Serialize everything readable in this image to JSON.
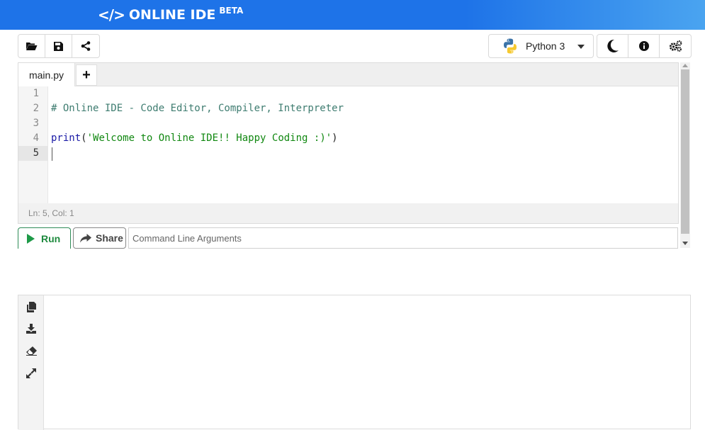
{
  "header": {
    "brand_symbol": "</>",
    "brand_name": "ONLINE IDE",
    "brand_badge": "BETA",
    "gradient_start": "#1e73e8",
    "gradient_end": "#4aa4f0"
  },
  "toolbar": {
    "left_icons": [
      "folder-open-icon",
      "save-icon",
      "share-nodes-icon"
    ],
    "language": "Python 3",
    "right_icons": [
      "moon-icon",
      "info-icon",
      "gears-icon"
    ]
  },
  "editor": {
    "tab_label": "main.py",
    "add_tab_label": "+",
    "line_numbers": [
      "1",
      "2",
      "3",
      "4",
      "5"
    ],
    "lines": {
      "l2": "# Online IDE - Code Editor, Compiler, Interpreter",
      "l4_fn": "print",
      "l4_open": "(",
      "l4_str": "'Welcome to Online IDE!! Happy Coding :)'",
      "l4_close": ")"
    },
    "status": "Ln: 5,  Col: 1"
  },
  "actions": {
    "run_label": "Run",
    "share_label": "Share",
    "args_placeholder": "Command Line Arguments",
    "run_color": "#1e9a48"
  },
  "output": {
    "icons": [
      "copy-icon",
      "download-icon",
      "eraser-icon",
      "expand-icon"
    ]
  }
}
